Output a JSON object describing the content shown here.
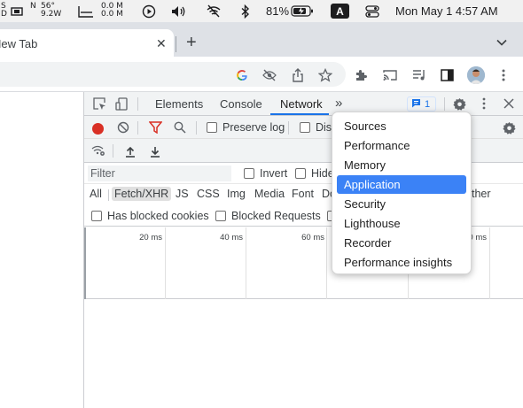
{
  "menubar": {
    "stats": {
      "s": "S",
      "d": "D",
      "temp": "56°",
      "power": "9.2W",
      "n": "N",
      "net_up": "0.0 M",
      "net_down": "0.0 M"
    },
    "battery": "81%",
    "input_source": "A",
    "datetime": "Mon May 1  4:57 AM"
  },
  "browser": {
    "tab_title": "New Tab",
    "close_symbol": "✕",
    "new_tab_symbol": "+",
    "tab_list_symbol": "⌄"
  },
  "devtools": {
    "tabs": [
      "Elements",
      "Console",
      "Network"
    ],
    "more_tabs": "»",
    "issues_count": "1",
    "network": {
      "preserve_log": "Preserve log",
      "disable_cache_partial": "Disa",
      "filter_placeholder": "Filter",
      "invert": "Invert",
      "hide_partial": "Hide",
      "types": [
        "All",
        "Fetch/XHR",
        "JS",
        "CSS",
        "Img",
        "Media",
        "Font",
        "Do"
      ],
      "other_partial": "ther",
      "blocked_cookies": "Has blocked cookies",
      "blocked_requests": "Blocked Requests",
      "timeline_ticks": [
        "20 ms",
        "40 ms",
        "60 ms",
        "0 ms"
      ]
    },
    "more_menu": [
      "Sources",
      "Performance",
      "Memory",
      "Application",
      "Security",
      "Lighthouse",
      "Recorder",
      "Performance insights"
    ],
    "highlighted_item": "Application"
  },
  "colors": {
    "accent": "#1a73e8",
    "record": "#d93025",
    "highlight": "#3b82f6",
    "filter_icon": "#d93025"
  },
  "icons": [
    "inspect-icon",
    "device-toolbar-icon",
    "settings-icon",
    "kebab-icon",
    "close-icon",
    "clear-icon",
    "filter-icon",
    "search-icon",
    "network-conditions-icon",
    "upload-icon",
    "download-icon",
    "google-icon",
    "eye-slash-icon",
    "share-icon",
    "star-icon",
    "extensions-icon",
    "cast-icon",
    "media-icon",
    "side-panel-icon",
    "avatar"
  ]
}
